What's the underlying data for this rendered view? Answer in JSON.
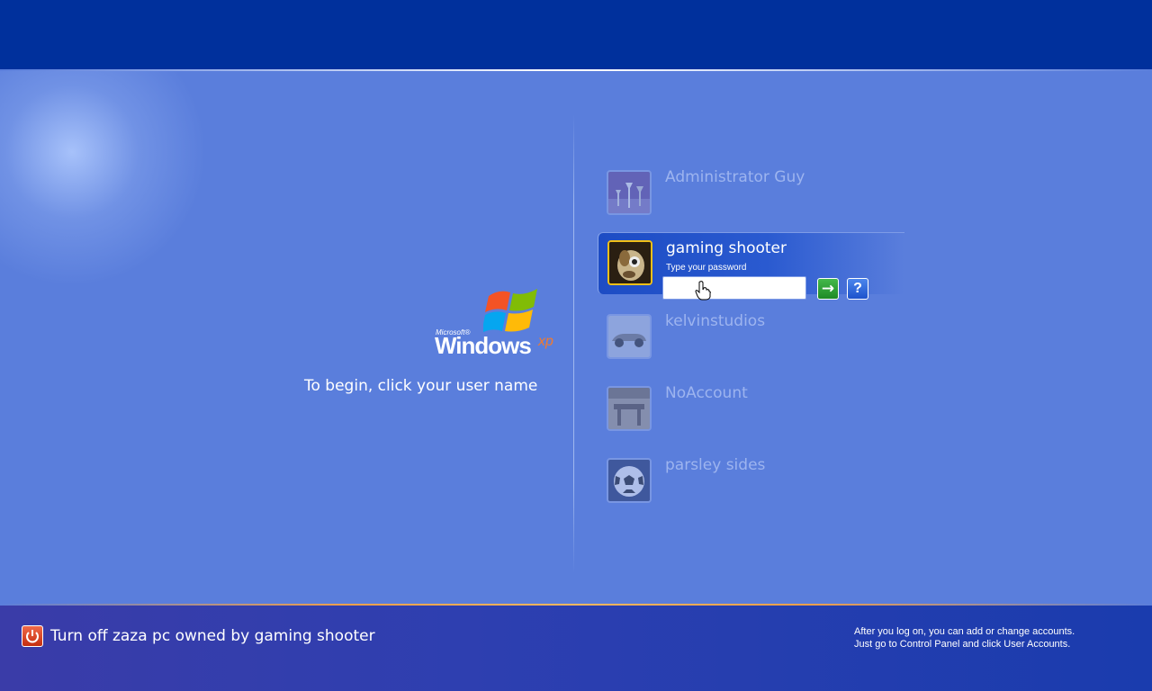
{
  "logo": {
    "ms": "Microsoft®",
    "windows": "Windows",
    "xp": "xp"
  },
  "begin_text": "To begin, click your user name",
  "users": [
    {
      "name": "Administrator Guy",
      "icon": "chess-icon"
    },
    {
      "name": "gaming shooter",
      "icon": "dog-icon",
      "selected": true,
      "password_label": "Type your password",
      "password_value": ""
    },
    {
      "name": "kelvinstudios",
      "icon": "car-icon"
    },
    {
      "name": "NoAccount",
      "icon": "table-icon"
    },
    {
      "name": "parsley sides",
      "icon": "soccer-ball-icon"
    }
  ],
  "buttons": {
    "go": "→",
    "help": "?"
  },
  "bottom": {
    "turnoff_label": "Turn off zaza pc owned by gaming shooter",
    "info_line1": "After you log on, you can add or change accounts.",
    "info_line2": "Just go to Control Panel and click User Accounts."
  },
  "colors": {
    "top_bar": "#00309c",
    "background": "#5a7edc",
    "selected_border": "#f0c018",
    "go_button": "#2e9e36",
    "power_button": "#d8452a"
  }
}
